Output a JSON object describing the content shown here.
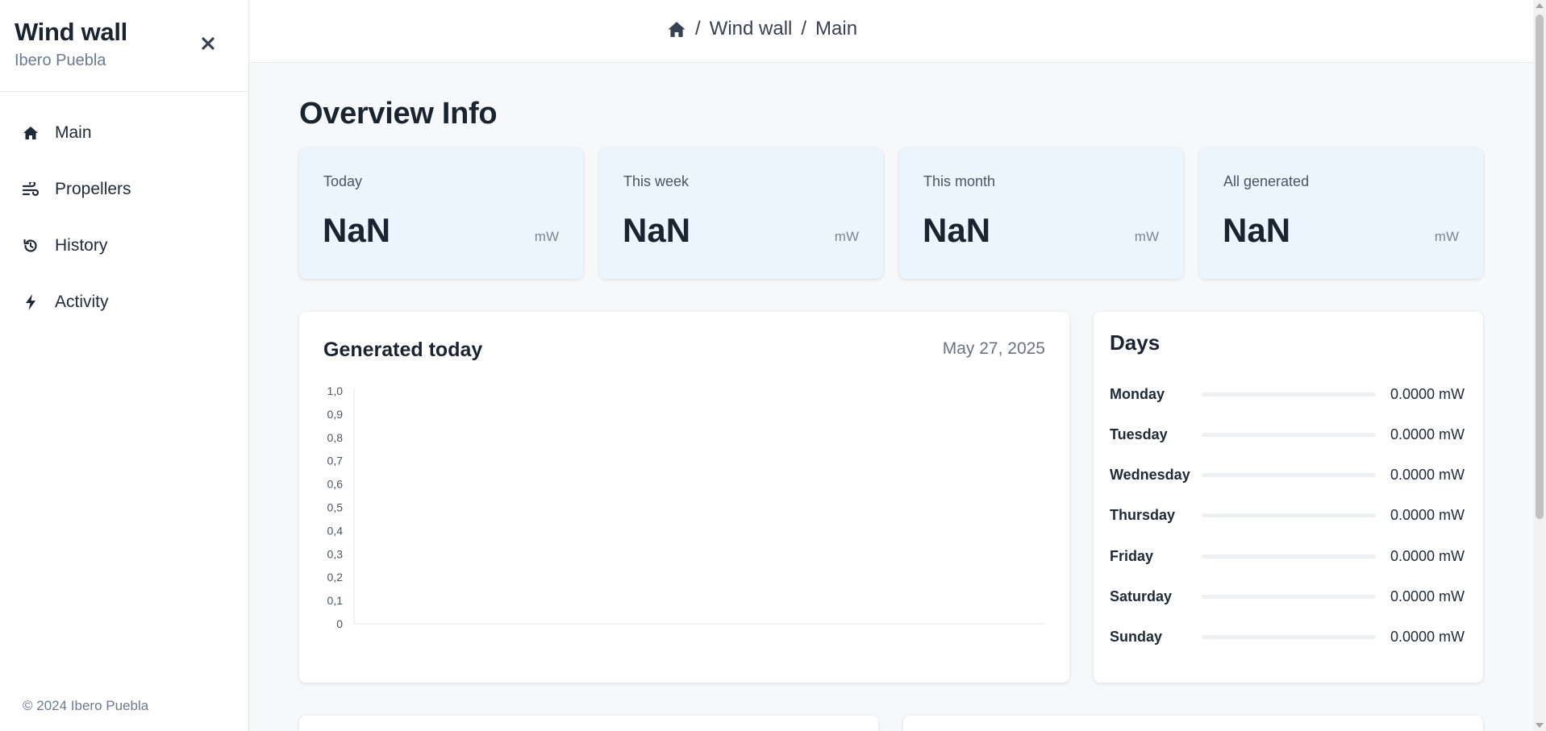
{
  "sidebar": {
    "title": "Wind wall",
    "subtitle": "Ibero Puebla",
    "close_icon": "close-icon",
    "items": [
      {
        "label": "Main",
        "icon": "home-icon"
      },
      {
        "label": "Propellers",
        "icon": "wind-icon"
      },
      {
        "label": "History",
        "icon": "history-icon"
      },
      {
        "label": "Activity",
        "icon": "bolt-icon"
      }
    ],
    "footer": "© 2024 Ibero Puebla"
  },
  "breadcrumb": {
    "home_icon": "home-icon",
    "separator": "/",
    "items": [
      "Wind wall",
      "Main"
    ]
  },
  "main": {
    "title": "Overview Info",
    "stats": [
      {
        "label": "Today",
        "value": "NaN",
        "unit": "mW"
      },
      {
        "label": "This week",
        "value": "NaN",
        "unit": "mW"
      },
      {
        "label": "This month",
        "value": "NaN",
        "unit": "mW"
      },
      {
        "label": "All generated",
        "value": "NaN",
        "unit": "mW"
      }
    ],
    "chart_card": {
      "title": "Generated today",
      "date": "May 27, 2025"
    },
    "days_card": {
      "title": "Days",
      "days": [
        {
          "name": "Monday",
          "value": "0.0000 mW",
          "fraction": 0
        },
        {
          "name": "Tuesday",
          "value": "0.0000 mW",
          "fraction": 0
        },
        {
          "name": "Wednesday",
          "value": "0.0000 mW",
          "fraction": 0
        },
        {
          "name": "Thursday",
          "value": "0.0000 mW",
          "fraction": 0
        },
        {
          "name": "Friday",
          "value": "0.0000 mW",
          "fraction": 0
        },
        {
          "name": "Saturday",
          "value": "0.0000 mW",
          "fraction": 0
        },
        {
          "name": "Sunday",
          "value": "0.0000 mW",
          "fraction": 0
        }
      ]
    }
  },
  "chart_data": {
    "type": "line",
    "title": "",
    "xlabel": "",
    "ylabel": "",
    "ylim": [
      0,
      1
    ],
    "y_ticks": [
      "0",
      "0,1",
      "0,2",
      "0,3",
      "0,4",
      "0,5",
      "0,6",
      "0,7",
      "0,8",
      "0,9",
      "1,0"
    ],
    "series": [],
    "grid": false
  },
  "colors": {
    "stat_bg": "#eaf5fd",
    "accent": "#38bdf8",
    "text_dark": "#1a2330",
    "text_muted": "#6b7a90"
  }
}
